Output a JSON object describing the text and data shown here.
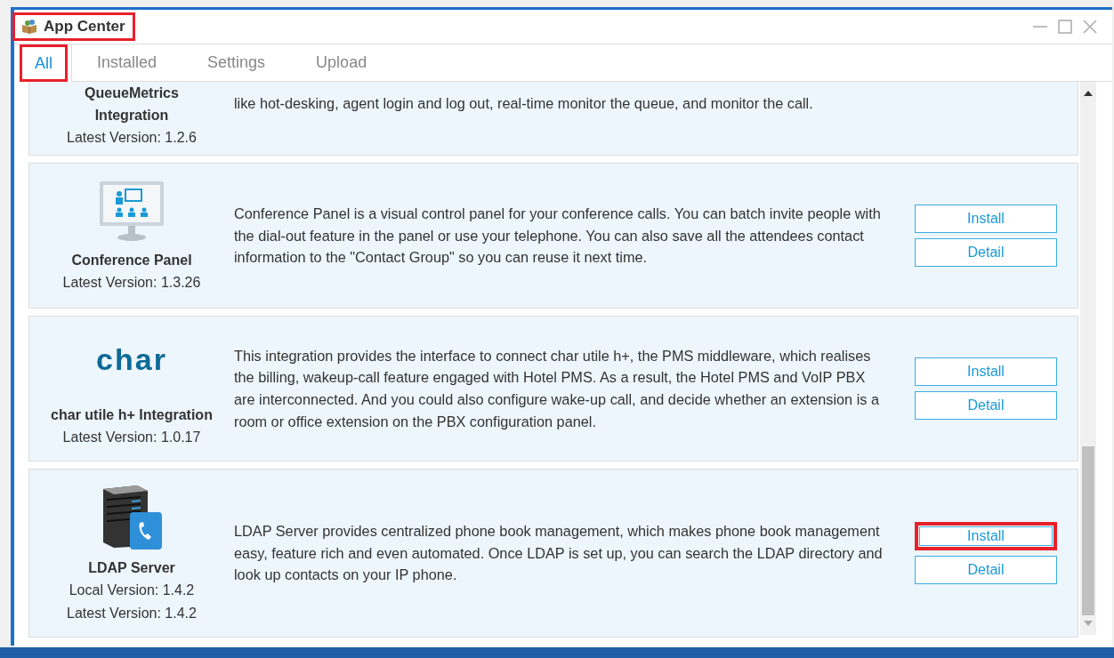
{
  "window": {
    "title": "App Center",
    "title_highlighted": true
  },
  "tabs": [
    {
      "label": "All",
      "selected": true,
      "highlighted": true
    },
    {
      "label": "Installed",
      "selected": false,
      "highlighted": false
    },
    {
      "label": "Settings",
      "selected": false,
      "highlighted": false
    },
    {
      "label": "Upload",
      "selected": false,
      "highlighted": false
    }
  ],
  "apps": [
    {
      "kind": "partial",
      "name": "QueueMetrics Integration",
      "versions": [
        "Latest Version: 1.2.6"
      ],
      "description": "like hot-desking, agent login and log out, real-time monitor the queue, and monitor the call."
    },
    {
      "kind": "monitor",
      "name": "Conference Panel",
      "versions": [
        "Latest Version: 1.3.26"
      ],
      "description": "Conference Panel is a visual control panel for your conference calls. You can batch invite people with the dial-out feature in the panel or use your telephone. You can also save all the attendees contact information to the \"Contact Group\" so you can reuse it next time.",
      "buttons": [
        {
          "label": "Install",
          "highlighted": false
        },
        {
          "label": "Detail",
          "highlighted": false
        }
      ]
    },
    {
      "kind": "logo",
      "logo_text": "char",
      "name": "char utile h+ Integration",
      "versions": [
        "Latest Version: 1.0.17"
      ],
      "description": "This integration provides the interface to connect char utile h+, the PMS middleware, which realises the billing, wakeup-call feature engaged with Hotel PMS. As a result, the Hotel PMS and VoIP PBX are interconnected. And you could also configure wake-up call, and decide whether an extension is a room or office extension on the PBX configuration panel.",
      "buttons": [
        {
          "label": "Install",
          "highlighted": false
        },
        {
          "label": "Detail",
          "highlighted": false
        }
      ]
    },
    {
      "kind": "server",
      "name": "LDAP Server",
      "versions": [
        "Local Version: 1.4.2",
        "Latest Version: 1.4.2"
      ],
      "description": "LDAP Server provides centralized phone book management, which makes phone book management easy, feature rich and even automated. Once LDAP is set up, you can search the LDAP directory and look up contacts on your IP phone.",
      "buttons": [
        {
          "label": "Install",
          "highlighted": true
        },
        {
          "label": "Detail",
          "highlighted": false
        }
      ]
    }
  ]
}
